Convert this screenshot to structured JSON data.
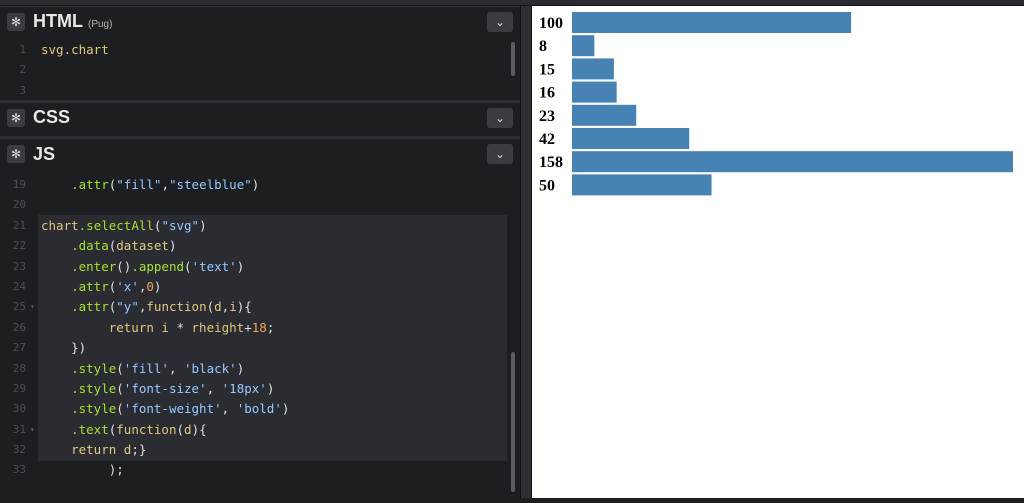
{
  "html_pane": {
    "title": "HTML",
    "subtitle": "(Pug)",
    "lines": [
      {
        "n": "1",
        "code": "svg.chart"
      },
      {
        "n": "2",
        "code": ""
      },
      {
        "n": "3",
        "code": ""
      }
    ]
  },
  "css_pane": {
    "title": "CSS"
  },
  "js_pane": {
    "title": "JS",
    "lines": [
      {
        "n": "19",
        "code": "    .attr(\"fill\",\"steelblue\")"
      },
      {
        "n": "20",
        "code": ""
      },
      {
        "n": "21",
        "code": "chart.selectAll(\"svg\")"
      },
      {
        "n": "22",
        "code": "    .data(dataset)"
      },
      {
        "n": "23",
        "code": "    .enter().append('text')"
      },
      {
        "n": "24",
        "code": "    .attr('x',0)"
      },
      {
        "n": "25",
        "code": "    .attr(\"y\",function(d,i){"
      },
      {
        "n": "26",
        "code": "         return i * rheight+18;"
      },
      {
        "n": "27",
        "code": "    })"
      },
      {
        "n": "28",
        "code": "    .style('fill', 'black')"
      },
      {
        "n": "29",
        "code": "    .style('font-size', '18px')"
      },
      {
        "n": "30",
        "code": "    .style('font-weight', 'bold')"
      },
      {
        "n": "31",
        "code": "    .text(function(d){"
      },
      {
        "n": "32",
        "code": "    return d;}"
      },
      {
        "n": "33",
        "code": "         );"
      }
    ]
  },
  "chart_data": {
    "type": "bar",
    "orientation": "horizontal",
    "values": [
      100,
      8,
      15,
      16,
      23,
      42,
      158,
      50
    ],
    "labels": [
      "100",
      "8",
      "15",
      "16",
      "23",
      "42",
      "158",
      "50"
    ],
    "bar_color": "#4682b4",
    "label_color": "#000000"
  },
  "colors": {
    "editor_bg": "#1d1e22",
    "preview_bg": "#ffffff",
    "bar": "#4682b4"
  },
  "icons": {
    "settings": "gear-icon",
    "collapse": "chevron-down-icon"
  }
}
